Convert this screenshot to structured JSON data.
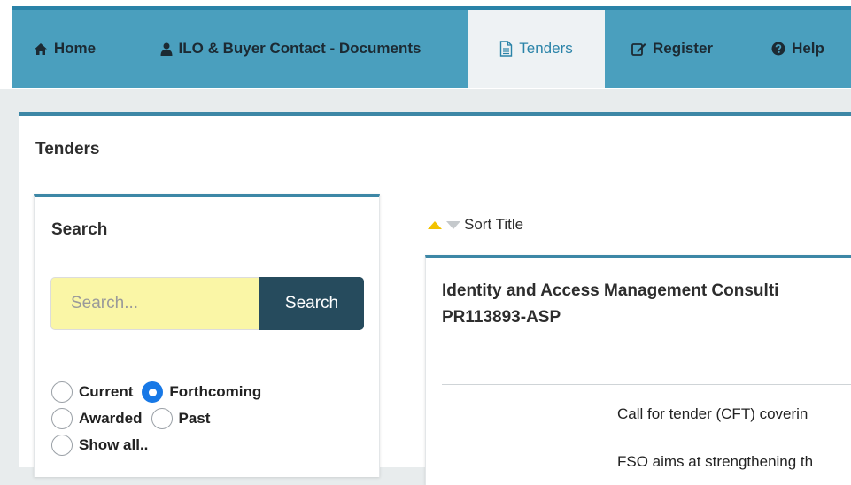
{
  "nav": {
    "items": [
      {
        "label": "Home",
        "icon": "home-icon"
      },
      {
        "label": "ILO & Buyer Contact - Documents",
        "icon": "user-icon"
      },
      {
        "label": "Tenders",
        "icon": "document-icon",
        "active": true
      },
      {
        "label": "Register",
        "icon": "edit-icon"
      },
      {
        "label": "Help",
        "icon": "question-circle-icon"
      }
    ]
  },
  "page": {
    "title": "Tenders"
  },
  "search": {
    "title": "Search",
    "placeholder": "Search...",
    "button_label": "Search",
    "filters": [
      {
        "label": "Current",
        "checked": false
      },
      {
        "label": "Forthcoming",
        "checked": true
      },
      {
        "label": "Awarded",
        "checked": false
      },
      {
        "label": "Past",
        "checked": false
      },
      {
        "label": "Show all..",
        "checked": false
      }
    ]
  },
  "sort": {
    "label": "Sort Title"
  },
  "results": [
    {
      "title_line1": "Identity and Access Management Consulti",
      "title_line2": "PR113893-ASP",
      "desc_line1": "Call for tender (CFT) coverin",
      "desc_line2": "FSO aims at strengthening th"
    }
  ],
  "colors": {
    "nav_bg": "#4a9fbe",
    "nav_active_text": "#2a83a8",
    "panel_border": "#3d87a6",
    "search_input_bg": "#faf6a6",
    "search_button_bg": "#264b5d",
    "radio_checked": "#1778e6",
    "sort_up": "#f2c200"
  }
}
